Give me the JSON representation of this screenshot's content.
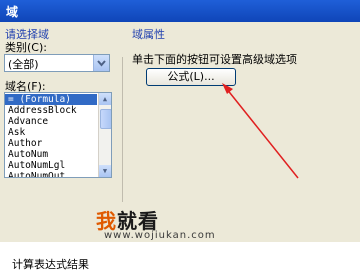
{
  "window": {
    "title": "域"
  },
  "left_panel": {
    "section_title": "请选择域",
    "category_label": "类别(C):",
    "category_value": "(全部)",
    "field_names_label": "域名(F):",
    "field_names": [
      "= (Formula)",
      "AddressBlock",
      "Advance",
      "Ask",
      "Author",
      "AutoNum",
      "AutoNumLgl",
      "AutoNumOut"
    ],
    "selected_index": 0
  },
  "right_panel": {
    "section_title": "域属性",
    "instruction": "单击下面的按钮可设置高级域选项",
    "formula_button": "公式(L)..."
  },
  "watermark": {
    "brand_highlight": "我",
    "brand_rest": "就看",
    "url": "www.wojiukan.com"
  },
  "bottom": {
    "text": "计算表达式结果"
  },
  "colors": {
    "titlebar": "#1f5fd8",
    "dialog_bg": "#ece9d8",
    "section_title": "#1f3faf",
    "selection": "#316ac5",
    "arrow": "#e02020"
  },
  "icons": {
    "combo_button": "chevron-down-icon",
    "scroll_up": "arrow-up-icon",
    "scroll_down": "arrow-down-icon"
  }
}
